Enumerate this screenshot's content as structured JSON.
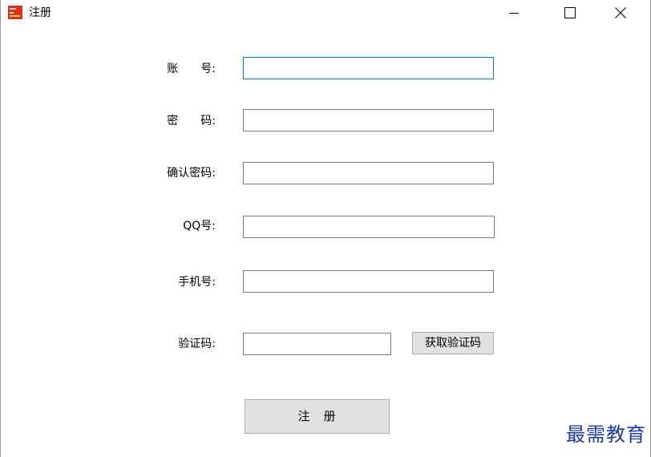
{
  "window": {
    "title": "注册",
    "minimize_symbol": "—",
    "maximize_symbol": "☐",
    "close_symbol": "✕"
  },
  "form": {
    "account_label": "账　　号:",
    "account_value": "",
    "password_label": "密　　码:",
    "password_value": "",
    "confirm_password_label": "确认密码:",
    "confirm_password_value": "",
    "qq_label": "QQ号:",
    "qq_value": "",
    "phone_label": "手机号:",
    "phone_value": "",
    "verification_label": "验证码:",
    "verification_value": "",
    "get_code_button": "获取验证码",
    "register_button": "注　册"
  },
  "watermark": {
    "text": "最需教育"
  },
  "colors": {
    "focus_border": "#0078d7",
    "button_bg": "#e1e1e1",
    "app_icon": "#d9311f",
    "watermark": "#1e3a9c"
  }
}
